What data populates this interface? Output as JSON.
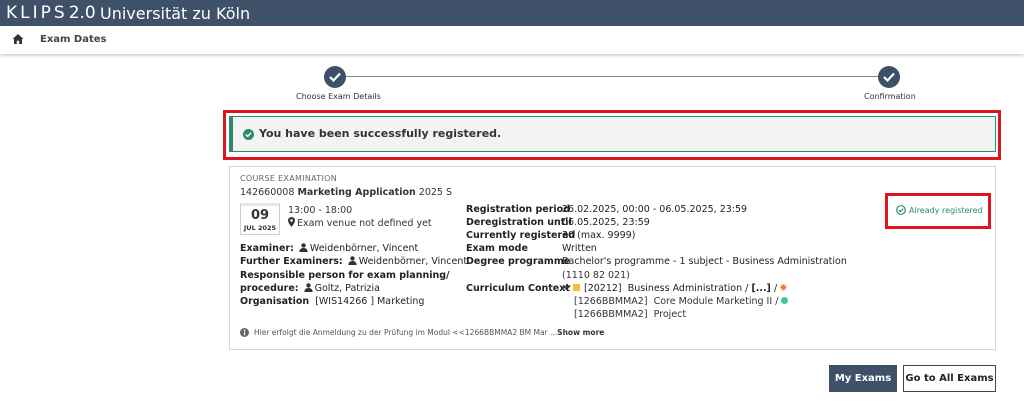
{
  "app": {
    "logo_text": "KLIPS",
    "logo_version": "2.0",
    "university": "Universität zu Köln"
  },
  "breadcrumb": {
    "home_icon": "home-icon",
    "current": "Exam Dates"
  },
  "stepper": {
    "steps": [
      {
        "label": "Choose Exam Details",
        "done": true
      },
      {
        "label": "Confirmation",
        "done": true
      }
    ]
  },
  "alert": {
    "icon": "check-circle-icon",
    "message": "You have been successfully registered."
  },
  "exam": {
    "type": "COURSE EXAMINATION",
    "number": "142660008",
    "title": "Marketing Application",
    "semester": "2025 S",
    "date_day": "09",
    "date_month": "JUL 2025",
    "time": "13:00 - 18:00",
    "venue": "Exam venue not defined yet",
    "examiner_label": "Examiner:",
    "examiner": "Weidenbörner, Vincent",
    "further_label": "Further Examiners:",
    "further": "Weidenbörner, Vincent",
    "responsible_label_1": "Responsible person for exam planning/",
    "responsible_label_2": "procedure:",
    "responsible": "Goltz, Patrizia",
    "org_label": "Organisation",
    "org": "[WIS14266 ] Marketing",
    "reg_period_label": "Registration period",
    "reg_period": "26.02.2025, 00:00 - 06.05.2025, 23:59",
    "dereg_label": "Deregistration until",
    "dereg": "06.05.2025, 23:59",
    "current_label": "Currently registered",
    "current": "30 (max. 9999)",
    "mode_label": "Exam mode",
    "mode": "Written",
    "degree_label": "Degree programme",
    "degree_1": "Bachelor's programme - 1 subject - Business Administration",
    "degree_2": "(1110 82 021)",
    "curriculum_label": "Curriculum Context",
    "curr_1_code": "[20212]",
    "curr_1_name": "Business Administration",
    "curr_1_sep": "/",
    "curr_1_more": "[...]",
    "curr_1_sep2": "/",
    "curr_2_code": "[1266BBMMA2]",
    "curr_2_name": "Core Module Marketing II",
    "curr_2_sep": "/",
    "curr_3_code": "[1266BBMMA2]",
    "curr_3_name": "Project",
    "status": "Already registered",
    "note": "Hier erfolgt die Anmeldung zu der Prüfung im Modul <<1266BBMMA2 BM Mar ...",
    "show_more": "Show more"
  },
  "buttons": {
    "my_exams": "My Exams",
    "all_exams": "Go to All Exams"
  },
  "colors": {
    "header": "#3f5069",
    "success": "#2f8a6b",
    "highlight": "#e0141e",
    "yellow": "#f2c12e",
    "orange": "#ef7d35",
    "green": "#3cc99a"
  }
}
